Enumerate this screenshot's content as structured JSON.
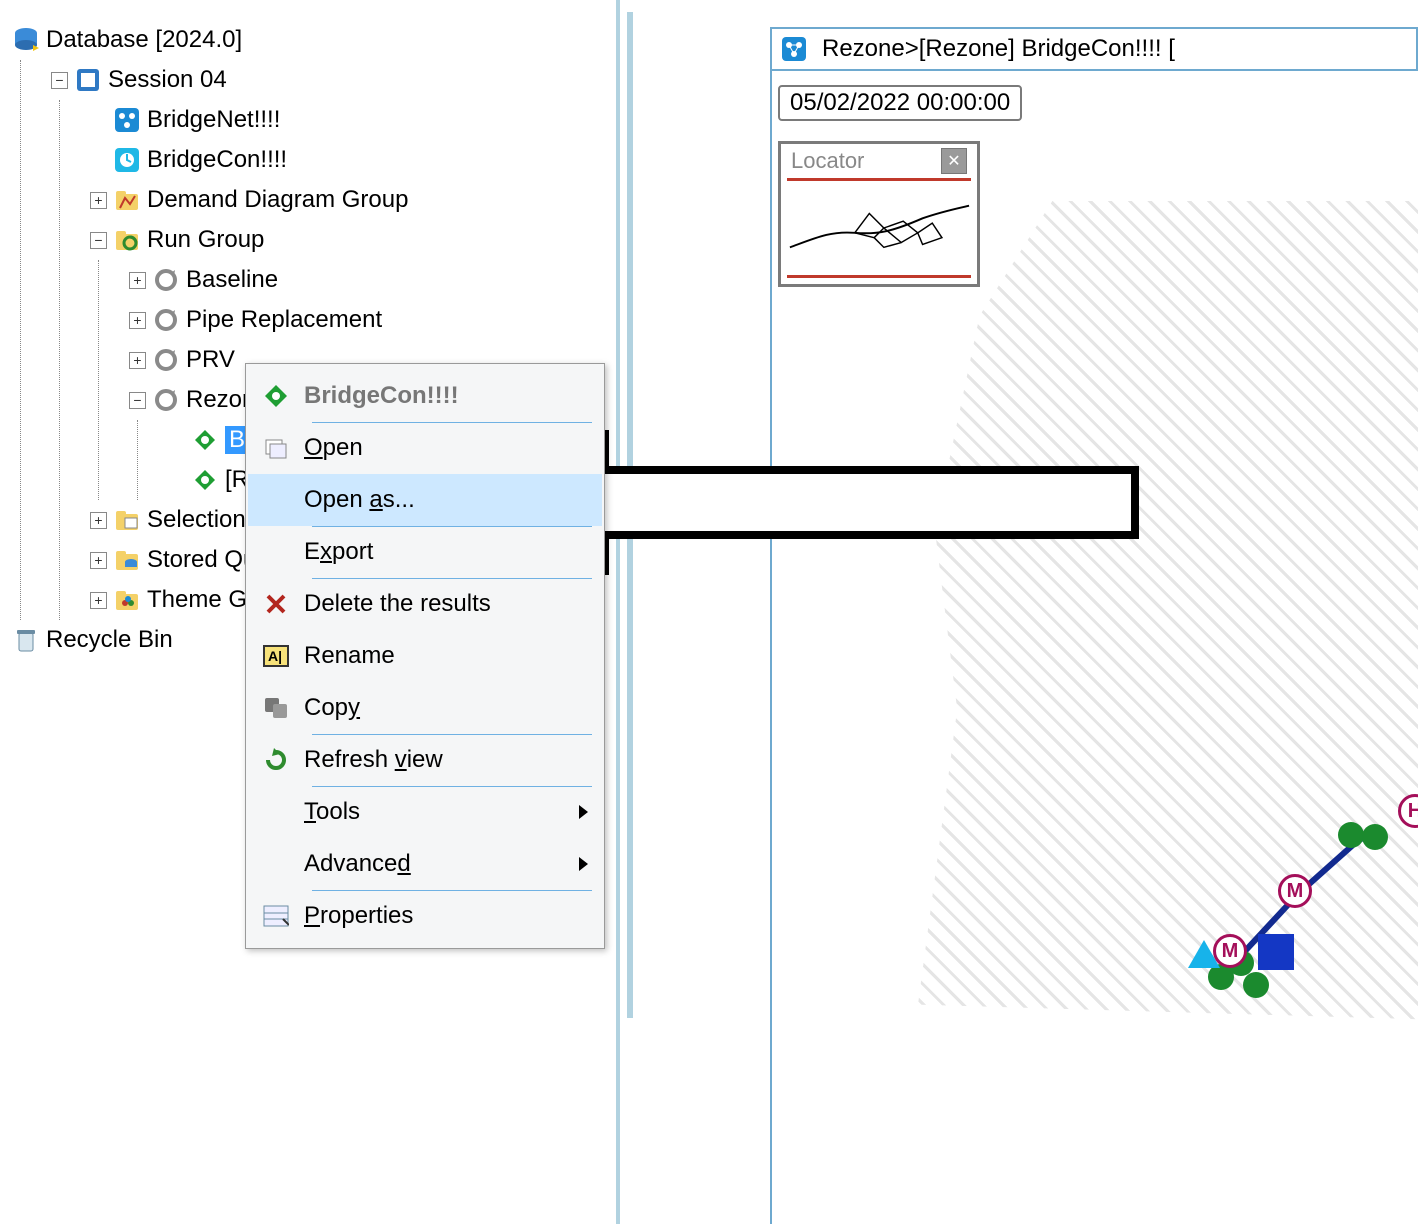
{
  "tree": {
    "root_label": "Database [2024.0]",
    "session_label": "Session 04",
    "bridgenet_label": "BridgeNet!!!!",
    "bridgecon_label": "BridgeCon!!!!",
    "demand_label": "Demand Diagram Group",
    "rungroup_label": "Run Group",
    "baseline_label": "Baseline",
    "pipe_label": "Pipe Replacement",
    "prv_label": "PRV",
    "rezone_label": "Rezone",
    "rezone_bridgecon_label": "BridgeCon!!!!",
    "rezone_sim_label": "[Rezone] BridgeCon!!!!",
    "sel_list_label": "Selection List Group",
    "stored_query_label": "Stored Query Group",
    "theme_group_label": "Theme Group",
    "recycle_label": "Recycle Bin"
  },
  "context_menu": {
    "title": "BridgeCon!!!!",
    "open": "Open",
    "open_as": "Open as...",
    "export": "Export",
    "delete": "Delete the results",
    "rename": "Rename",
    "copy": "Copy",
    "refresh": "Refresh view",
    "tools": "Tools",
    "advanced": "Advanced",
    "properties": "Properties"
  },
  "view": {
    "title": "Rezone>[Rezone] BridgeCon!!!!  [",
    "timestamp": "05/02/2022 00:00:00",
    "locator_title": "Locator"
  },
  "glyphs": {
    "m": "M",
    "h": "H"
  }
}
